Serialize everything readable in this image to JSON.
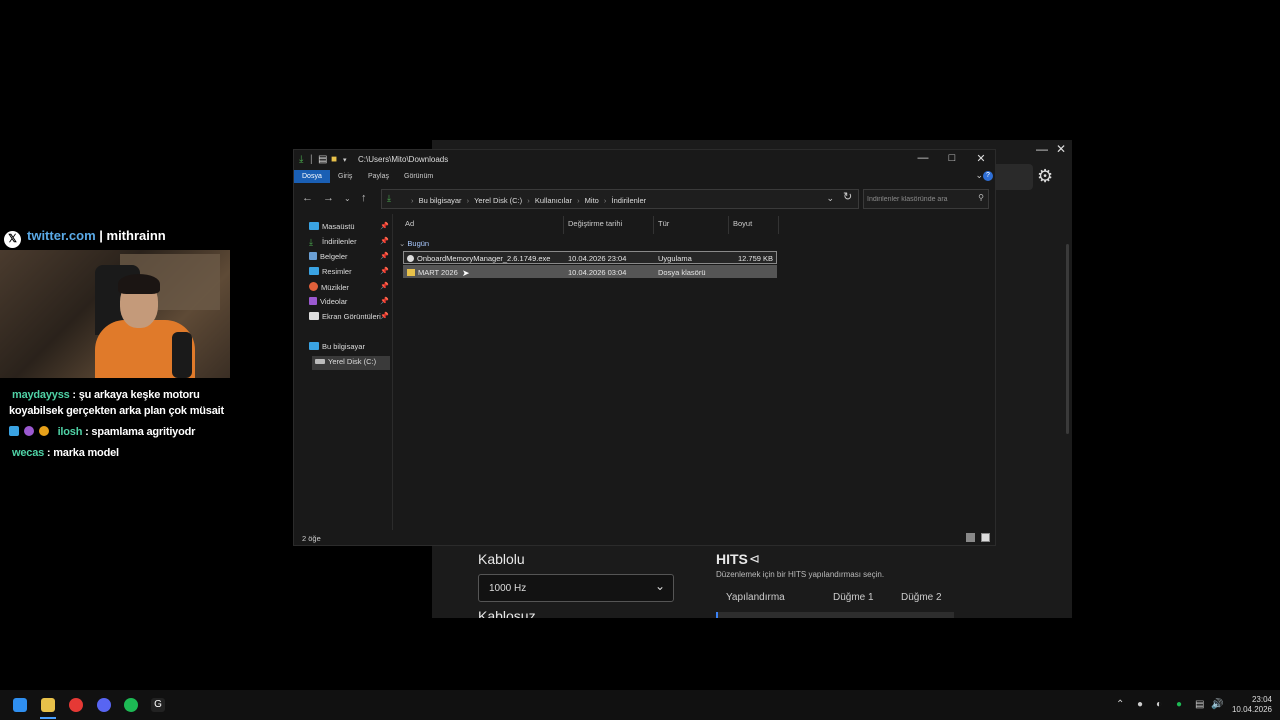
{
  "explorer": {
    "title_path": "C:\\Users\\Mito\\Downloads",
    "ribbon_tabs": [
      "Dosya",
      "Giriş",
      "Paylaş",
      "Görünüm"
    ],
    "breadcrumb": [
      "Bu bilgisayar",
      "Yerel Disk (C:)",
      "Kullanıcılar",
      "Mito",
      "İndirilenler"
    ],
    "search_placeholder": "İndirilenler klasöründe ara",
    "nav_pane": {
      "quick_access": [
        {
          "label": "Masaüstü",
          "icon": "desktop-icon",
          "color": "#3aa3e3"
        },
        {
          "label": "İndirilenler",
          "icon": "download-icon",
          "color": "#4caf50"
        },
        {
          "label": "Belgeler",
          "icon": "documents-icon",
          "color": "#6a9fd4"
        },
        {
          "label": "Resimler",
          "icon": "pictures-icon",
          "color": "#3aa3e3"
        },
        {
          "label": "Müzikler",
          "icon": "music-icon",
          "color": "#e0603a"
        },
        {
          "label": "Videolar",
          "icon": "videos-icon",
          "color": "#9b59d0"
        },
        {
          "label": "Ekran Görüntüleri",
          "icon": "folder-icon",
          "color": "#dcdcdc"
        }
      ],
      "this_pc": "Bu bilgisayar",
      "local_disk": "Yerel Disk (C:)"
    },
    "columns": [
      "Ad",
      "Değiştirme tarihi",
      "Tür",
      "Boyut"
    ],
    "group_label": "Bugün",
    "files": [
      {
        "name": "OnboardMemoryManager_2.6.1749.exe",
        "modified": "10.04.2026 23:04",
        "type": "Uygulama",
        "size": "12.759 KB",
        "icon": "exe-icon"
      },
      {
        "name": "MART 2026",
        "modified": "10.04.2026 03:04",
        "type": "Dosya klasörü",
        "size": "",
        "icon": "folder-icon"
      }
    ],
    "status": "2 öğe"
  },
  "background_app": {
    "wired_title": "Kablolu",
    "polling_rate": "1000 Hz",
    "wireless_title": "Kablosuz",
    "hits_title": "HITS",
    "hits_subtitle": "Düzenlemek için bir HITS yapılandırması seçin.",
    "hits_columns": [
      "Yapılandırma",
      "Düğme 1",
      "Düğme 2"
    ]
  },
  "overlay": {
    "twitter_site": "twitter.com",
    "twitter_sep": "|",
    "twitter_user": "mithrainn",
    "chat": [
      {
        "user": "maydayyss",
        "text": ": şu arkaya keşke motoru"
      },
      {
        "user": "",
        "text": "koyabilsek gerçekten arka plan çok müsait"
      },
      {
        "user": "ilosh",
        "text": ": spamlama agritiyodr"
      },
      {
        "user": "wecas",
        "text": ": marka model"
      }
    ]
  },
  "taskbar": {
    "time": "23:04",
    "date": "10.04.2026"
  }
}
